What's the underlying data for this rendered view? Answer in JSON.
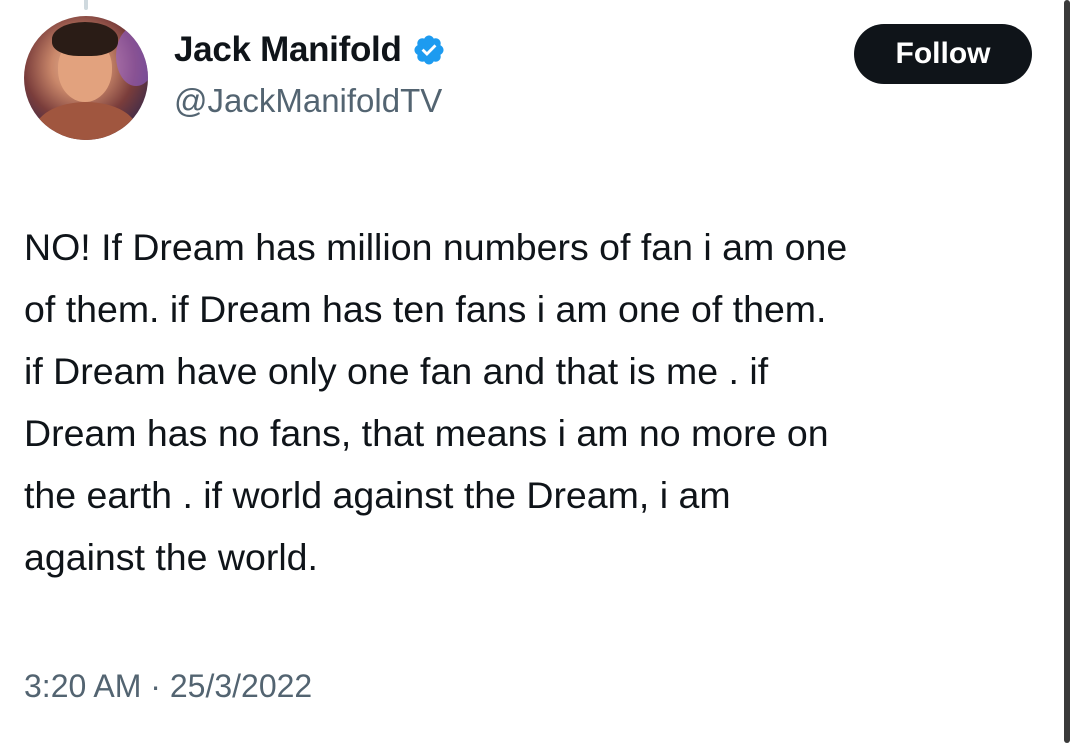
{
  "author": {
    "display_name": "Jack Manifold",
    "handle": "@JackManifoldTV",
    "verified": true,
    "verified_icon": "verified-badge-icon",
    "verified_color": "#1d9bf0"
  },
  "follow_button": {
    "label": "Follow"
  },
  "tweet": {
    "text_lines": [
      "NO! If Dream has million numbers of fan i am one",
      "of them. if Dream has ten fans i am one of them.",
      "if Dream have only one fan and that is me . if",
      "Dream has no fans, that means i am no more on",
      "the earth . if world against the Dream, i am",
      "against the world."
    ],
    "timestamp": "3:20 AM · 25/3/2022"
  },
  "colors": {
    "text_primary": "#0f1419",
    "text_secondary": "#536471",
    "button_bg": "#0f1419",
    "button_text": "#ffffff"
  }
}
